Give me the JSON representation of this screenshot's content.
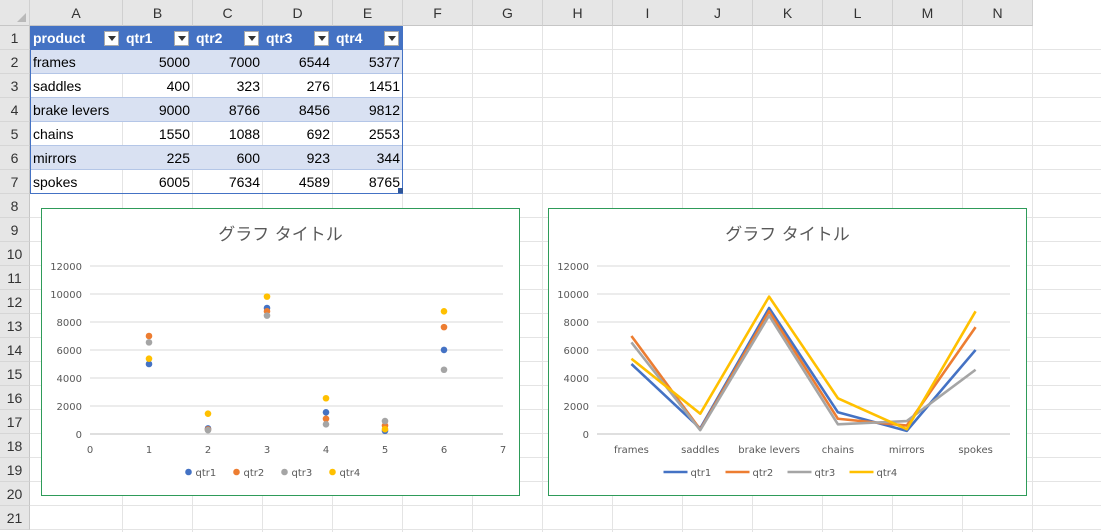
{
  "sheet": {
    "columns": [
      "A",
      "B",
      "C",
      "D",
      "E",
      "F",
      "G",
      "H",
      "I",
      "J",
      "K",
      "L",
      "M",
      "N"
    ],
    "rows": [
      "1",
      "2",
      "3",
      "4",
      "5",
      "6",
      "7",
      "8",
      "9",
      "10",
      "11",
      "12",
      "13",
      "14",
      "15",
      "16",
      "17",
      "18",
      "19",
      "20",
      "21"
    ]
  },
  "table": {
    "headers": [
      "product",
      "qtr1",
      "qtr2",
      "qtr3",
      "qtr4"
    ],
    "rows": [
      [
        "frames",
        "5000",
        "7000",
        "6544",
        "5377"
      ],
      [
        "saddles",
        "400",
        "323",
        "276",
        "1451"
      ],
      [
        "brake levers",
        "9000",
        "8766",
        "8456",
        "9812"
      ],
      [
        "chains",
        "1550",
        "1088",
        "692",
        "2553"
      ],
      [
        "mirrors",
        "225",
        "600",
        "923",
        "344"
      ],
      [
        "spokes",
        "6005",
        "7634",
        "4589",
        "8765"
      ]
    ]
  },
  "chart_data": [
    {
      "type": "scatter",
      "title": "グラフ タイトル",
      "x": [
        1,
        2,
        3,
        4,
        5,
        6
      ],
      "series": [
        {
          "name": "qtr1",
          "values": [
            5000,
            400,
            9000,
            1550,
            225,
            6005
          ],
          "color": "#4472c4"
        },
        {
          "name": "qtr2",
          "values": [
            7000,
            323,
            8766,
            1088,
            600,
            7634
          ],
          "color": "#ed7d31"
        },
        {
          "name": "qtr3",
          "values": [
            6544,
            276,
            8456,
            692,
            923,
            4589
          ],
          "color": "#a5a5a5"
        },
        {
          "name": "qtr4",
          "values": [
            5377,
            1451,
            9812,
            2553,
            344,
            8765
          ],
          "color": "#ffc000"
        }
      ],
      "xlim": [
        0,
        7
      ],
      "ylim": [
        0,
        12000
      ],
      "x_ticks": [
        "0",
        "1",
        "2",
        "3",
        "4",
        "5",
        "6",
        "7"
      ],
      "y_ticks": [
        "0",
        "2000",
        "4000",
        "6000",
        "8000",
        "10000",
        "12000"
      ],
      "grid": true,
      "legend": "bottom"
    },
    {
      "type": "line",
      "title": "グラフ タイトル",
      "categories": [
        "frames",
        "saddles",
        "brake levers",
        "chains",
        "mirrors",
        "spokes"
      ],
      "series": [
        {
          "name": "qtr1",
          "values": [
            5000,
            400,
            9000,
            1550,
            225,
            6005
          ],
          "color": "#4472c4"
        },
        {
          "name": "qtr2",
          "values": [
            7000,
            323,
            8766,
            1088,
            600,
            7634
          ],
          "color": "#ed7d31"
        },
        {
          "name": "qtr3",
          "values": [
            6544,
            276,
            8456,
            692,
            923,
            4589
          ],
          "color": "#a5a5a5"
        },
        {
          "name": "qtr4",
          "values": [
            5377,
            1451,
            9812,
            2553,
            344,
            8765
          ],
          "color": "#ffc000"
        }
      ],
      "ylim": [
        0,
        12000
      ],
      "y_ticks": [
        "0",
        "2000",
        "4000",
        "6000",
        "8000",
        "10000",
        "12000"
      ],
      "grid": true,
      "legend": "bottom"
    }
  ]
}
